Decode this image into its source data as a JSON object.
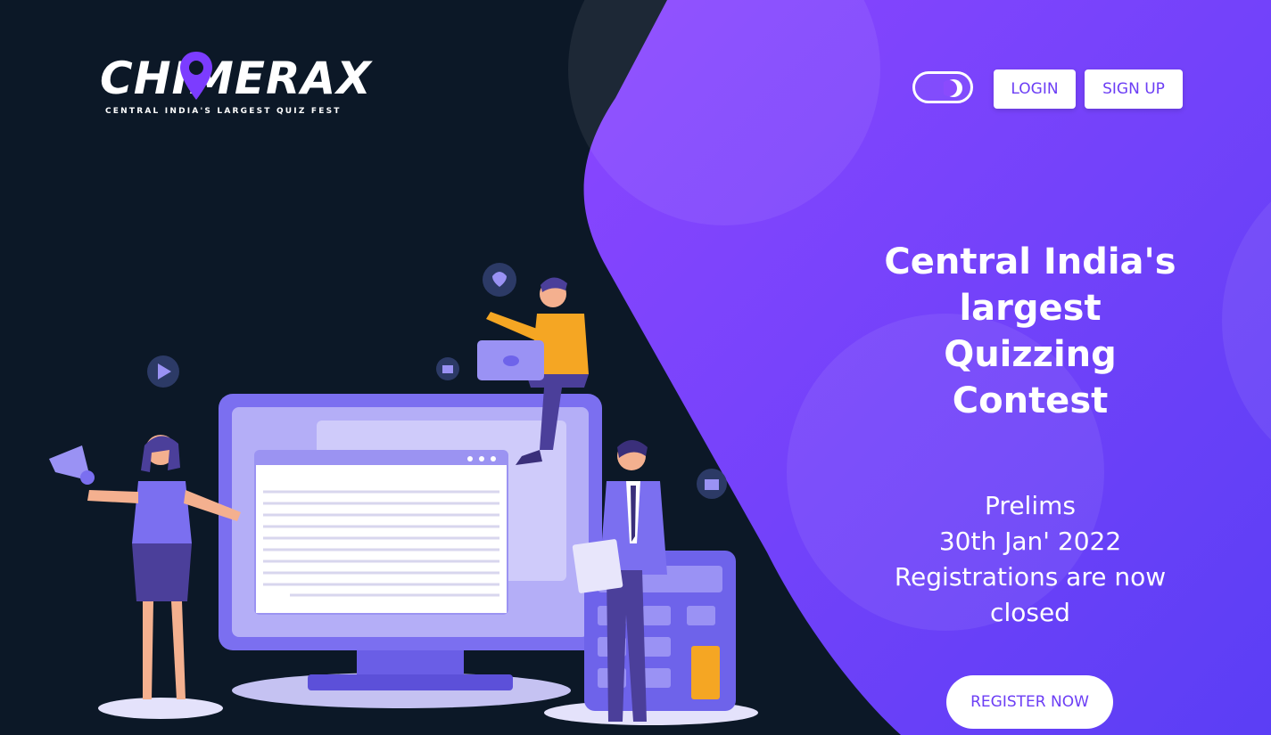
{
  "header": {
    "logo_text": "CHIMERAX",
    "logo_tagline": "CENTRAL INDIA'S LARGEST QUIZ FEST",
    "theme_toggle_icon": "moon-icon",
    "login_label": "LOGIN",
    "signup_label": "SIGN UP"
  },
  "hero": {
    "title_line1": "Central India's",
    "title_line2": "largest Quizzing",
    "title_line3": "Contest",
    "event_name": "Prelims",
    "event_date": "30th Jan' 2022",
    "status_line1": "Registrations are now",
    "status_line2": "closed",
    "register_label": "REGISTER NOW"
  },
  "colors": {
    "background": "#0c1827",
    "accent": "#6c3ef5",
    "hero_gradient_start": "#8a4bfd",
    "hero_gradient_end": "#5a3cf6",
    "button_bg": "#ffffff"
  }
}
